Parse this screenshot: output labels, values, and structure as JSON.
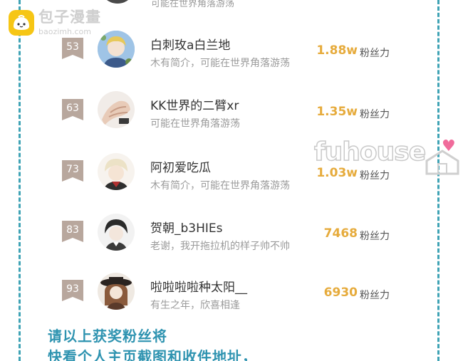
{
  "watermark": {
    "title": "包子漫畫",
    "subtitle": "baozimh.com",
    "right_text": "fuhouse"
  },
  "top_clip": {
    "bio": "可能在世界角落游荡"
  },
  "fans_label": "粉丝力",
  "rows": [
    {
      "rank": "53",
      "name": "白刺玫a白兰地",
      "bio": "木有简介，可能在世界角落游荡",
      "fans": "1.88w"
    },
    {
      "rank": "63",
      "name": "KK世界的二臂xr",
      "bio": "可能在世界角落游荡",
      "fans": "1.35w"
    },
    {
      "rank": "73",
      "name": "阿初爱吃瓜",
      "bio": "木有简介，可能在世界角落游荡",
      "fans": "1.03w"
    },
    {
      "rank": "83",
      "name": "贺朝_b3HIEs",
      "bio": "老谢，我开拖拉机的样子帅不帅",
      "fans": "7468"
    },
    {
      "rank": "93",
      "name": "啦啦啦啦种太阳__",
      "bio": "有生之年，欣喜相逢",
      "fans": "6930"
    }
  ],
  "footer": {
    "line1": "请以上获奖粉丝将",
    "line2": "快看个人主页截图和收件地址，"
  },
  "colors": {
    "rank_badge": "#b8a79d",
    "fans_value": "#e6ab3c",
    "border": "#3fa3b5",
    "footer_text": "#2e93b0"
  }
}
